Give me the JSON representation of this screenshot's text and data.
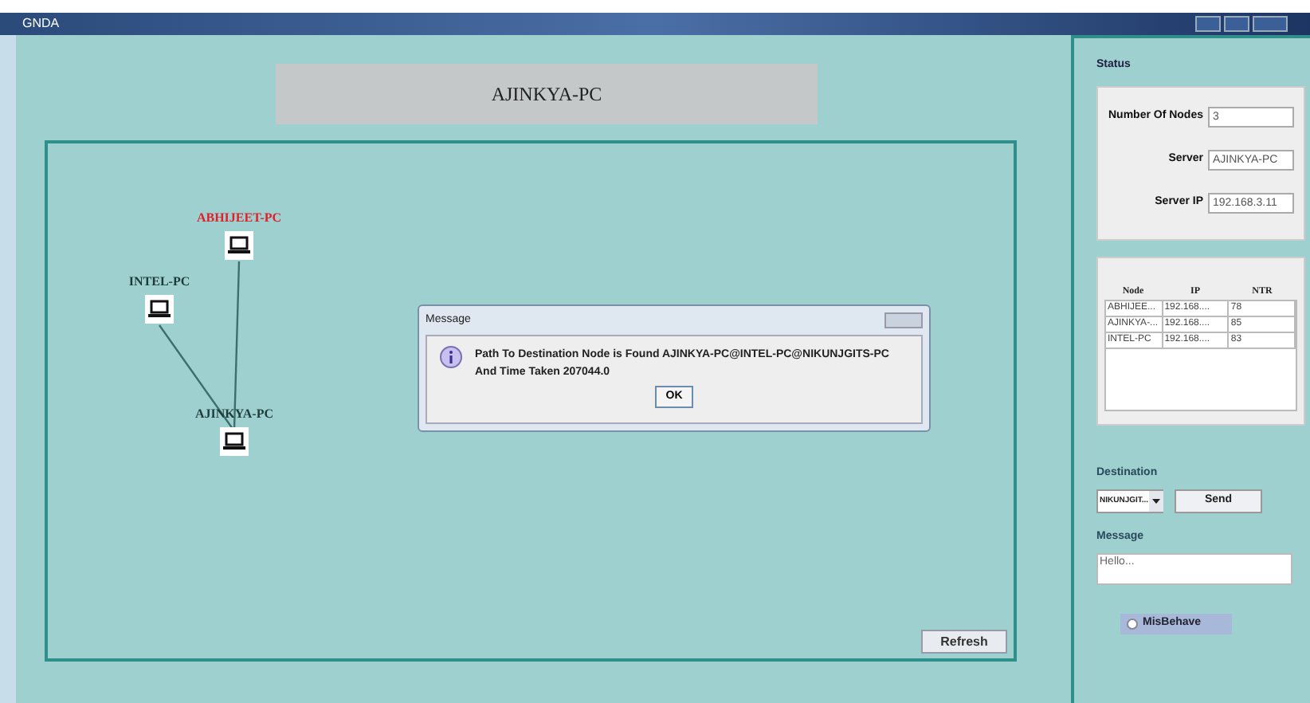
{
  "window": {
    "title": "GNDA"
  },
  "header": "AJINKYA-PC",
  "nodes": [
    {
      "label": "ABHIJEET-PC",
      "color": "#e0202a"
    },
    {
      "label": "INTEL-PC",
      "color": "#1f3a3a"
    },
    {
      "label": "AJINKYA-PC",
      "color": "#1f3a3a"
    }
  ],
  "dialog": {
    "title": "Message",
    "lines": [
      "Path To Destination Node is Found AJINKYA-PC@INTEL-PC@NIKUNJGITS-PC",
      "And Time Taken 207044.0"
    ],
    "ok": "OK"
  },
  "refresh": "Refresh",
  "status": {
    "title": "Status",
    "fields": [
      {
        "label": "Number Of Nodes",
        "value": "3"
      },
      {
        "label": "Server",
        "value": "AJINKYA-PC"
      },
      {
        "label": "Server IP",
        "value": "192.168.3.11"
      }
    ]
  },
  "table": {
    "columns": [
      "Node",
      "IP",
      "NTR"
    ],
    "rows": [
      [
        "ABHIJEE...",
        "192.168....",
        "78"
      ],
      [
        "AJINKYA-...",
        "192.168....",
        "85"
      ],
      [
        "INTEL-PC",
        "192.168....",
        "83"
      ]
    ]
  },
  "destination": {
    "label": "Destination",
    "value": "NIKUNJGIT...",
    "send": "Send"
  },
  "message": {
    "label": "Message",
    "value": "Hello..."
  },
  "misbehave": {
    "label": "MisBehave",
    "selected": false
  }
}
